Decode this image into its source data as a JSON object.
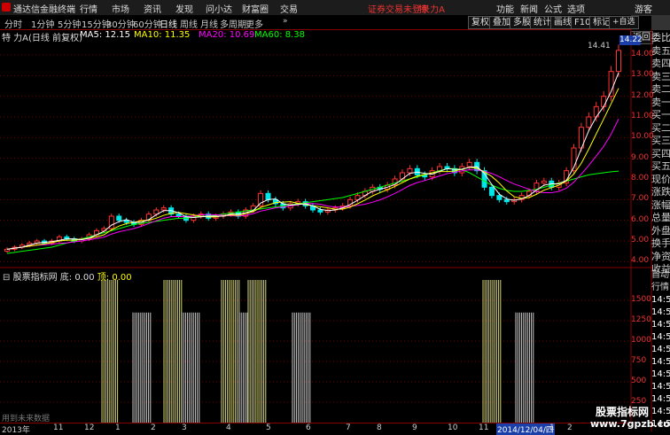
{
  "menubar": {
    "app_name": "通达信金融终端",
    "items": [
      "行情",
      "市场",
      "资讯",
      "发现",
      "问小达",
      "财富圈",
      "交易"
    ],
    "login_status": "证券交易未登录",
    "stock_name": "特 力A",
    "right_items": [
      "功能",
      "新闻",
      "公式",
      "选项"
    ],
    "user": "游客"
  },
  "toolbar": {
    "periods": [
      "分时",
      "1分钟",
      "5分钟",
      "15分钟",
      "30分钟",
      "60分钟",
      "日线",
      "周线",
      "月线",
      "多周期",
      "更多"
    ],
    "active_period": "日线",
    "right_buttons": [
      "复权",
      "叠加",
      "多股",
      "统计",
      "画线",
      "F10",
      "标记",
      "+自选",
      "返回"
    ]
  },
  "chart_title": {
    "stock": "特 力A",
    "mode": "(日线 前复权)",
    "ma5": "MA5: 12.15",
    "ma10": "MA10: 11.35",
    "ma20": "MA20: 10.69",
    "ma60": "MA60: 8.38",
    "colors": {
      "ma5": "#ffffff",
      "ma10": "#ffff00",
      "ma20": "#ff00ff",
      "ma60": "#00ff00"
    }
  },
  "price_tag": "14.22",
  "high_label": "14.41",
  "right_panel": [
    "委比",
    "卖五",
    "卖四",
    "卖三",
    "卖二",
    "卖一",
    "买一",
    "买二",
    "买三",
    "买四",
    "买五",
    "现价",
    "涨跌",
    "涨幅",
    "总量",
    "外盘",
    "换手",
    "净资",
    "收益"
  ],
  "right_panel2": [
    "自动",
    "行情",
    "14:5",
    "14:5",
    "14:5",
    "14:5",
    "14:5",
    "14:5",
    "14:5",
    "14:5",
    "14:5",
    "14:5",
    "14:5"
  ],
  "indicator": {
    "name": "股票指标网",
    "bottom_label": "底: 0.00",
    "top_label": "顶: 0.00",
    "no_data": "用到未来数据"
  },
  "x_axis": {
    "labels": [
      "2013年",
      "11",
      "12",
      "1",
      "2",
      "3",
      "4",
      "5",
      "6",
      "7",
      "8",
      "9",
      "10",
      "11",
      "1",
      "2"
    ],
    "cursor_date": "2014/12/04/四"
  },
  "watermark": {
    "line1": "股票指标网",
    "line2": "www.7gpzb.com"
  },
  "chart_data": [
    {
      "type": "candlestick",
      "title": "",
      "ylim": [
        3.8,
        14.6
      ],
      "y_ticks": [
        14.0,
        13.0,
        12.0,
        11.0,
        10.0,
        9.0,
        8.0,
        7.0,
        6.0,
        5.0,
        4.0
      ],
      "close_series": [
        4.6,
        4.7,
        4.8,
        4.9,
        5.0,
        4.9,
        5.0,
        5.2,
        5.1,
        5.0,
        5.1,
        5.3,
        5.5,
        5.6,
        6.2,
        6.0,
        5.9,
        5.8,
        6.0,
        6.3,
        6.5,
        6.6,
        6.3,
        6.2,
        6.0,
        6.2,
        6.3,
        6.1,
        6.2,
        6.3,
        6.4,
        6.2,
        6.5,
        6.7,
        7.3,
        7.0,
        6.8,
        6.6,
        6.8,
        6.9,
        6.7,
        6.5,
        6.4,
        6.5,
        6.6,
        6.7,
        7.0,
        7.2,
        7.4,
        7.6,
        7.5,
        7.7,
        8.0,
        8.3,
        8.5,
        8.2,
        8.1,
        8.4,
        8.6,
        8.5,
        8.3,
        8.6,
        8.8,
        8.4,
        7.6,
        7.2,
        7.0,
        6.9,
        7.0,
        7.2,
        7.4,
        7.8,
        7.9,
        7.6,
        7.8,
        8.4,
        9.5,
        10.5,
        11.0,
        11.5,
        12.0,
        13.2,
        14.22
      ],
      "ma60_series": [
        4.4,
        4.45,
        4.5,
        4.55,
        4.6,
        4.65,
        4.7,
        4.8,
        4.9,
        5.0,
        5.1,
        5.2,
        5.3,
        5.4,
        5.5,
        5.6,
        5.7,
        5.8,
        5.85,
        5.9,
        5.95,
        6.0,
        6.05,
        6.1,
        6.1,
        6.15,
        6.2,
        6.2,
        6.25,
        6.3,
        6.35,
        6.4,
        6.45,
        6.5,
        6.55,
        6.6,
        6.65,
        6.7,
        6.75,
        6.8,
        6.85,
        6.9,
        6.95,
        7.0,
        7.05,
        7.1,
        7.2,
        7.3,
        7.4,
        7.5,
        7.6,
        7.7,
        7.8,
        7.9,
        8.0,
        8.1,
        8.2,
        8.3,
        8.4,
        8.5,
        8.5,
        8.45,
        8.3,
        8.1,
        7.9,
        7.7,
        7.55,
        7.45,
        7.4,
        7.4,
        7.45,
        7.5,
        7.6,
        7.7,
        7.8,
        7.9,
        8.0,
        8.1,
        8.2,
        8.25,
        8.3,
        8.35,
        8.38
      ]
    },
    {
      "type": "bar",
      "title": "股票指标网",
      "ylim": [
        0,
        1750
      ],
      "y_ticks": [
        1500,
        1250,
        1000,
        750,
        500,
        250
      ],
      "groups": [
        {
          "color": "#d6d67a",
          "value": 1750,
          "start": 0.22,
          "end": 0.255
        },
        {
          "color": "#cccccc",
          "value": 1350,
          "start": 0.275,
          "end": 0.305
        },
        {
          "color": "#d6d67a",
          "value": 1750,
          "start": 0.335,
          "end": 0.36
        },
        {
          "color": "#cccccc",
          "value": 1350,
          "start": 0.36,
          "end": 0.39
        },
        {
          "color": "#d6d67a",
          "value": 1750,
          "start": 0.445,
          "end": 0.475
        },
        {
          "color": "#cccccc",
          "value": 1350,
          "start": 0.475,
          "end": 0.49
        },
        {
          "color": "#d6d67a",
          "value": 1750,
          "start": 0.5,
          "end": 0.535
        },
        {
          "color": "#cccccc",
          "value": 1350,
          "start": 0.59,
          "end": 0.62
        },
        {
          "color": "#d6d67a",
          "value": 1750,
          "start": 0.975,
          "end": 1.0
        }
      ]
    }
  ]
}
